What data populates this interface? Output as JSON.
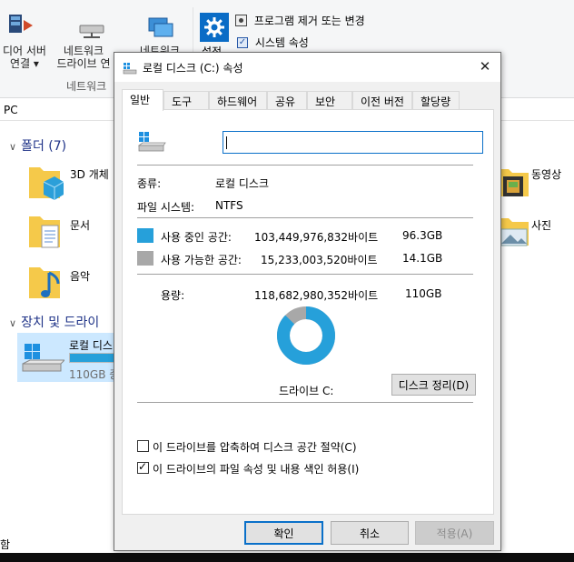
{
  "ribbon": {
    "media_server_label_1": "디어 서버",
    "media_server_label_2": "연결 ▾",
    "map_drive_label_1": "네트워크",
    "map_drive_label_2": "드라이브 연",
    "network_label_1": "네트워크",
    "network_group": "네트워크",
    "settings_label": "설정",
    "uninstall_label": "프로그램 제거 또는 변경",
    "system_props_label": "시스템 속성"
  },
  "address": {
    "text": "PC"
  },
  "folders": {
    "header": "폴더 (7)",
    "items": [
      "3D 개체",
      "문서",
      "음악",
      "동영상",
      "사진"
    ]
  },
  "devices": {
    "header": "장치 및 드라이",
    "drive_name": "로컬 디스",
    "drive_size": "110GB 중",
    "drive_fill": 0.87
  },
  "status_bar": {
    "text": "함"
  },
  "dialog": {
    "title": "로컬 디스크 (C:) 속성",
    "tabs": [
      "일반",
      "도구",
      "하드웨어",
      "공유",
      "보안",
      "이전 버전",
      "할당량"
    ],
    "active_tab": "일반",
    "name_value": "",
    "type_label": "종류:",
    "type_value": "로컬 디스크",
    "fs_label": "파일 시스템:",
    "fs_value": "NTFS",
    "used": {
      "label": "사용 중인 공간:",
      "bytes": "103,449,976,832바이트",
      "size": "96.3GB",
      "color": "#26a0da"
    },
    "free": {
      "label": "사용 가능한 공간:",
      "bytes": "15,233,003,520바이트",
      "size": "14.1GB",
      "color": "#a8a8a8"
    },
    "capacity": {
      "label": "용량:",
      "bytes": "118,682,980,352바이트",
      "size": "110GB"
    },
    "used_fraction": 0.8716,
    "drive_label": "드라이브 C:",
    "cleanup_button": "디스크 정리(D)",
    "compress_checkbox": {
      "label": "이 드라이브를 압축하여 디스크 공간 절약(C)",
      "checked": false
    },
    "index_checkbox": {
      "label": "이 드라이브의 파일 속성 및 내용 색인 허용(I)",
      "checked": true
    },
    "ok_button": "확인",
    "cancel_button": "취소",
    "apply_button": "적용(A)",
    "close_symbol": "✕"
  }
}
